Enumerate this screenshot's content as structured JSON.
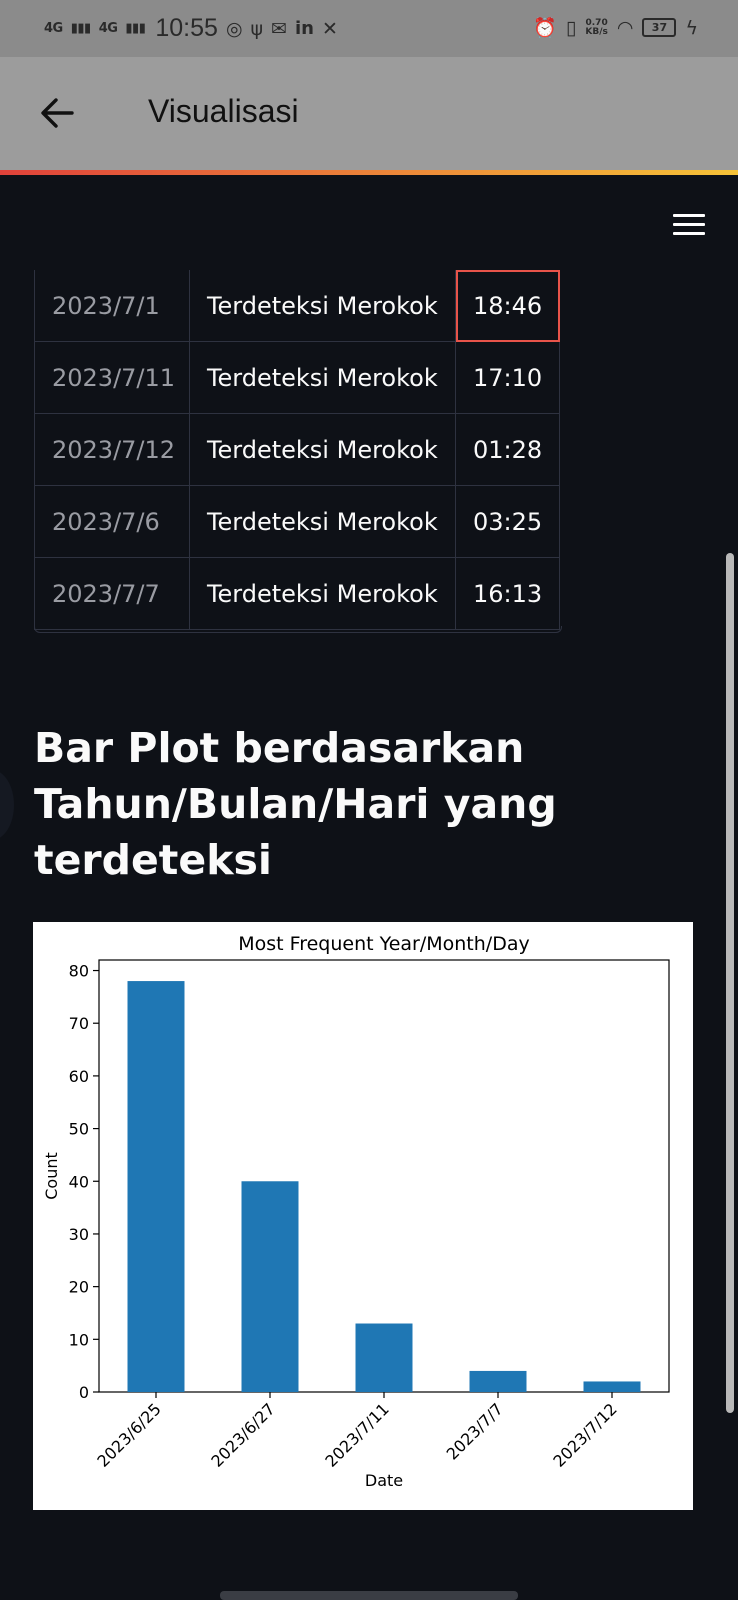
{
  "status_bar": {
    "signal1": "4G",
    "signal2": "4G",
    "time": "10:55",
    "net_speed_value": "0.70",
    "net_speed_unit": "KB/s",
    "battery": "37",
    "icons": [
      "whatsapp-icon",
      "usb-icon",
      "mail-icon",
      "linkedin-icon",
      "tools-icon",
      "alarm-icon",
      "vibrate-icon",
      "wifi-icon",
      "battery-icon",
      "charging-icon"
    ]
  },
  "appbar": {
    "title": "Visualisasi",
    "back_icon": "arrow-left-icon"
  },
  "table": {
    "rows": [
      {
        "date": "2023/7/1",
        "status": "Terdeteksi Merokok",
        "time": "18:46"
      },
      {
        "date": "2023/7/11",
        "status": "Terdeteksi Merokok",
        "time": "17:10"
      },
      {
        "date": "2023/7/12",
        "status": "Terdeteksi Merokok",
        "time": "01:28"
      },
      {
        "date": "2023/7/6",
        "status": "Terdeteksi Merokok",
        "time": "03:25"
      },
      {
        "date": "2023/7/7",
        "status": "Terdeteksi Merokok",
        "time": "16:13"
      }
    ]
  },
  "section": {
    "heading": "Bar Plot berdasarkan Tahun/Bulan/Hari yang terdeteksi"
  },
  "chart_data": {
    "type": "bar",
    "title": "Most Frequent Year/Month/Day",
    "xlabel": "Date",
    "ylabel": "Count",
    "categories": [
      "2023/6/25",
      "2023/6/27",
      "2023/7/11",
      "2023/7/7",
      "2023/7/12"
    ],
    "values": [
      78,
      40,
      13,
      4,
      2
    ],
    "ylim": [
      0,
      82
    ],
    "yticks": [
      0,
      10,
      20,
      30,
      40,
      50,
      60,
      70,
      80
    ],
    "bar_color": "#1f77b4",
    "grid": false
  }
}
